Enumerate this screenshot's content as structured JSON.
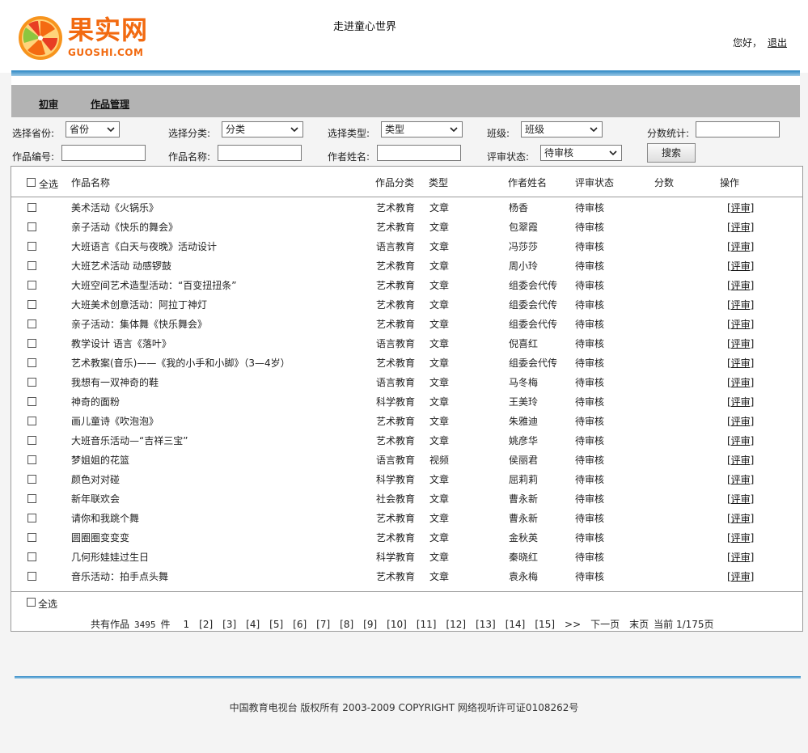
{
  "header": {
    "logo_cn": "果实网",
    "logo_en": "GUOSHI.COM",
    "site_title": "走进童心世界",
    "greeting": "您好，",
    "logout": "退出"
  },
  "nav": {
    "items": [
      "初审",
      "作品管理"
    ]
  },
  "filters": {
    "province_label": "选择省份:",
    "province_value": "省份",
    "category_label": "选择分类:",
    "category_value": "分类",
    "type_label": "选择类型:",
    "type_value": "类型",
    "class_label": "班级:",
    "class_value": "班级",
    "score_label": "分数统计:",
    "work_no_label": "作品编号:",
    "work_name_label": "作品名称:",
    "author_label": "作者姓名:",
    "status_label": "评审状态:",
    "status_value": "待审核",
    "search_button": "搜索"
  },
  "table": {
    "select_all": "全选",
    "headers": [
      "作品名称",
      "作品分类",
      "类型",
      "作者姓名",
      "评审状态",
      "分数",
      "操作"
    ],
    "review_label": "[评审]",
    "rows": [
      {
        "name": "美术活动《火锅乐》",
        "category": "艺术教育",
        "type": "文章",
        "author": "杨香",
        "status": "待审核"
      },
      {
        "name": "亲子活动《快乐的舞会》",
        "category": "艺术教育",
        "type": "文章",
        "author": "包翠霞",
        "status": "待审核"
      },
      {
        "name": "大班语言《白天与夜晚》活动设计",
        "category": "语言教育",
        "type": "文章",
        "author": "冯莎莎",
        "status": "待审核"
      },
      {
        "name": "大班艺术活动 动感锣鼓",
        "category": "艺术教育",
        "type": "文章",
        "author": "周小玲",
        "status": "待审核"
      },
      {
        "name": "大班空间艺术造型活动：“百变扭扭条”",
        "category": "艺术教育",
        "type": "文章",
        "author": "组委会代传",
        "status": "待审核"
      },
      {
        "name": "大班美术创意活动：阿拉丁神灯",
        "category": "艺术教育",
        "type": "文章",
        "author": "组委会代传",
        "status": "待审核"
      },
      {
        "name": "亲子活动：集体舞《快乐舞会》",
        "category": "艺术教育",
        "type": "文章",
        "author": "组委会代传",
        "status": "待审核"
      },
      {
        "name": "教学设计 语言《落叶》",
        "category": "语言教育",
        "type": "文章",
        "author": "倪喜红",
        "status": "待审核"
      },
      {
        "name": "艺术教案(音乐)——《我的小手和小脚》（3—4岁）",
        "category": "艺术教育",
        "type": "文章",
        "author": "组委会代传",
        "status": "待审核"
      },
      {
        "name": "我想有一双神奇的鞋",
        "category": "语言教育",
        "type": "文章",
        "author": "马冬梅",
        "status": "待审核"
      },
      {
        "name": "神奇的面粉",
        "category": "科学教育",
        "type": "文章",
        "author": "王美玲",
        "status": "待审核"
      },
      {
        "name": "画儿童诗《吹泡泡》",
        "category": "艺术教育",
        "type": "文章",
        "author": "朱雅迪",
        "status": "待审核"
      },
      {
        "name": "大班音乐活动—“吉祥三宝”",
        "category": "艺术教育",
        "type": "文章",
        "author": "姚彦华",
        "status": "待审核"
      },
      {
        "name": "梦姐姐的花篮",
        "category": "语言教育",
        "type": "视频",
        "author": "侯丽君",
        "status": "待审核"
      },
      {
        "name": "颜色对对碰",
        "category": "科学教育",
        "type": "文章",
        "author": "屈莉莉",
        "status": "待审核"
      },
      {
        "name": "新年联欢会",
        "category": "社会教育",
        "type": "文章",
        "author": "曹永新",
        "status": "待审核"
      },
      {
        "name": "请你和我跳个舞",
        "category": "艺术教育",
        "type": "文章",
        "author": "曹永新",
        "status": "待审核"
      },
      {
        "name": "圆圈圈变变变",
        "category": "艺术教育",
        "type": "文章",
        "author": "金秋英",
        "status": "待审核"
      },
      {
        "name": "几何形娃娃过生日",
        "category": "科学教育",
        "type": "文章",
        "author": "秦晓红",
        "status": "待审核"
      },
      {
        "name": "音乐活动：拍手点头舞",
        "category": "艺术教育",
        "type": "文章",
        "author": "袁永梅",
        "status": "待审核"
      }
    ]
  },
  "pager": {
    "total_prefix": "共有作品",
    "total_count": "3495",
    "total_suffix": "件",
    "pages": [
      "1",
      "[2]",
      "[3]",
      "[4]",
      "[5]",
      "[6]",
      "[7]",
      "[8]",
      "[9]",
      "[10]",
      "[11]",
      "[12]",
      "[13]",
      "[14]",
      "[15]",
      ">>"
    ],
    "next": "下一页",
    "last": "末页",
    "current": "当前 1/175页"
  },
  "footer": {
    "copyright": "中国教育电视台 版权所有 2003-2009 COPYRIGHT 网络视听许可证0108262号"
  }
}
